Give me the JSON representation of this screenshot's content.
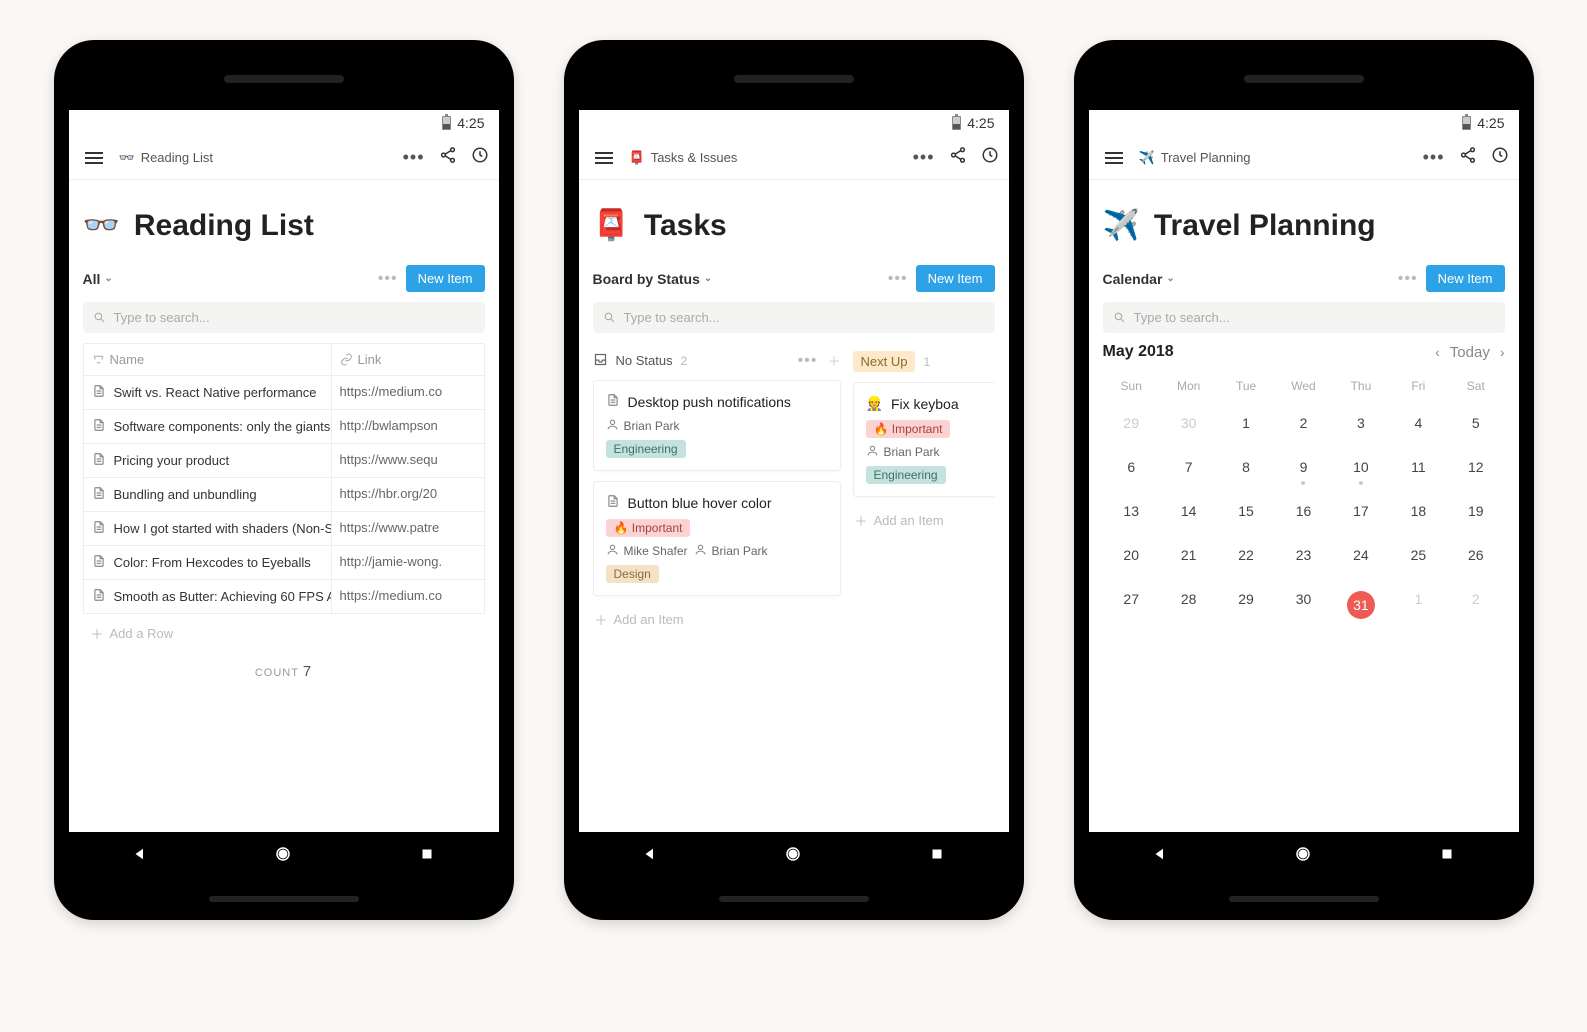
{
  "status": {
    "time": "4:25"
  },
  "phones": [
    {
      "appbar": {
        "icon": "👓",
        "title": "Reading List"
      },
      "page": {
        "icon": "👓",
        "title": "Reading List"
      },
      "view": {
        "name": "All",
        "newItem": "New Item",
        "searchPlaceholder": "Type to search..."
      },
      "table": {
        "headers": {
          "name": "Name",
          "link": "Link"
        },
        "rows": [
          {
            "name": "Swift vs. React Native performance",
            "link": "https://medium.co"
          },
          {
            "name": "Software components: only the giants",
            "link": "http://bwlampson"
          },
          {
            "name": "Pricing your product",
            "link": "https://www.sequ"
          },
          {
            "name": "Bundling and unbundling",
            "link": "https://hbr.org/20"
          },
          {
            "name": "How I got started with shaders (Non-S",
            "link": "https://www.patre"
          },
          {
            "name": "Color: From Hexcodes to Eyeballs",
            "link": "http://jamie-wong."
          },
          {
            "name": "Smooth as Butter: Achieving 60 FPS A",
            "link": "https://medium.co"
          }
        ],
        "addRow": "Add a Row",
        "countLabel": "COUNT",
        "count": "7"
      }
    },
    {
      "appbar": {
        "icon": "📮",
        "title": "Tasks & Issues"
      },
      "page": {
        "icon": "📮",
        "title": "Tasks"
      },
      "view": {
        "name": "Board by Status",
        "newItem": "New Item",
        "searchPlaceholder": "Type to search..."
      },
      "board": {
        "columns": [
          {
            "name": "No Status",
            "count": "2",
            "cards": [
              {
                "title": "Desktop push notifications",
                "people": [
                  "Brian Park"
                ],
                "tags": [
                  {
                    "label": "Engineering",
                    "class": "tag-engineering"
                  }
                ]
              },
              {
                "title": "Button blue hover color",
                "important": true,
                "importantLabel": "Important",
                "people": [
                  "Mike Shafer",
                  "Brian Park"
                ],
                "tags": [
                  {
                    "label": "Design",
                    "class": "tag-design"
                  }
                ]
              }
            ],
            "addItem": "Add an Item"
          },
          {
            "name": "Next Up",
            "count": "1",
            "cards": [
              {
                "icon": "👷",
                "title": "Fix keyboa",
                "important": true,
                "importantLabel": "Important",
                "people": [
                  "Brian Park"
                ],
                "tags": [
                  {
                    "label": "Engineering",
                    "class": "tag-engineering"
                  }
                ]
              }
            ],
            "addItem": "Add an Item"
          }
        ]
      }
    },
    {
      "appbar": {
        "icon": "✈️",
        "title": "Travel Planning"
      },
      "page": {
        "icon": "✈️",
        "title": "Travel Planning"
      },
      "view": {
        "name": "Calendar",
        "newItem": "New Item",
        "searchPlaceholder": "Type to search..."
      },
      "calendar": {
        "month": "May 2018",
        "today": "Today",
        "dow": [
          "Sun",
          "Mon",
          "Tue",
          "Wed",
          "Thu",
          "Fri",
          "Sat"
        ],
        "days": [
          {
            "n": "29",
            "out": true
          },
          {
            "n": "30",
            "out": true
          },
          {
            "n": "1"
          },
          {
            "n": "2"
          },
          {
            "n": "3"
          },
          {
            "n": "4"
          },
          {
            "n": "5"
          },
          {
            "n": "6"
          },
          {
            "n": "7"
          },
          {
            "n": "8"
          },
          {
            "n": "9",
            "dot": true
          },
          {
            "n": "10",
            "dot": true
          },
          {
            "n": "11"
          },
          {
            "n": "12"
          },
          {
            "n": "13"
          },
          {
            "n": "14"
          },
          {
            "n": "15"
          },
          {
            "n": "16"
          },
          {
            "n": "17"
          },
          {
            "n": "18"
          },
          {
            "n": "19"
          },
          {
            "n": "20"
          },
          {
            "n": "21"
          },
          {
            "n": "22"
          },
          {
            "n": "23"
          },
          {
            "n": "24"
          },
          {
            "n": "25"
          },
          {
            "n": "26"
          },
          {
            "n": "27"
          },
          {
            "n": "28"
          },
          {
            "n": "29"
          },
          {
            "n": "30"
          },
          {
            "n": "31",
            "selected": true
          },
          {
            "n": "1",
            "out": true
          },
          {
            "n": "2",
            "out": true
          }
        ]
      }
    }
  ]
}
